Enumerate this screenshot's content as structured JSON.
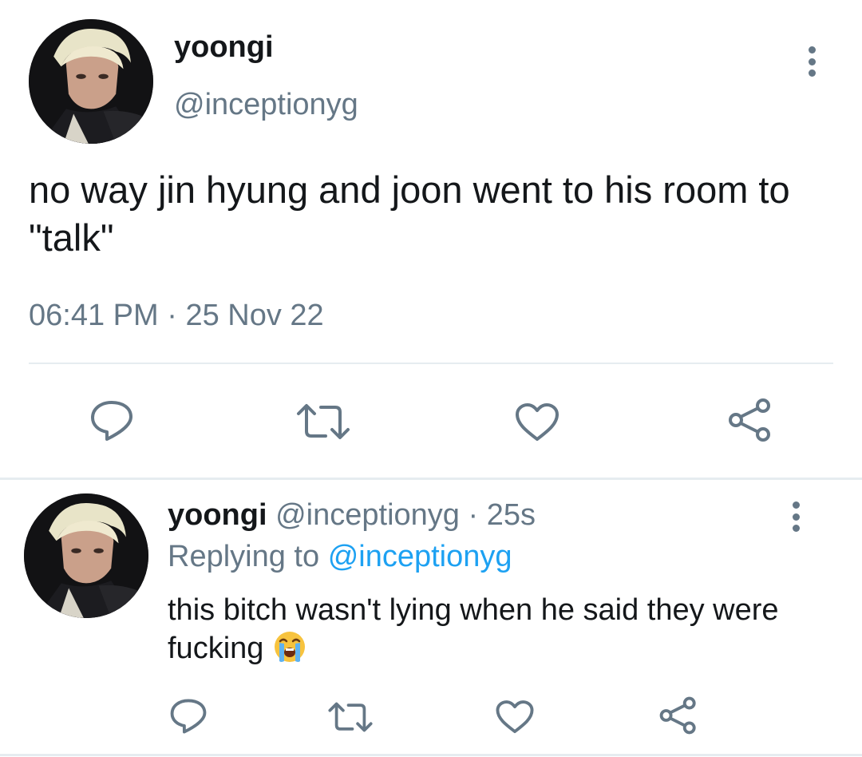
{
  "main_tweet": {
    "display_name": "yoongi",
    "handle": "@inceptionyg",
    "text": "no way jin hyung and joon went to his room to \"talk\"",
    "time": "06:41 PM",
    "separator": "·",
    "date": "25 Nov 22"
  },
  "reply_tweet": {
    "display_name": "yoongi",
    "handle": "@inceptionyg",
    "separator": "·",
    "age": "25s",
    "replying_prefix": "Replying to",
    "replying_mention": "@inceptionyg",
    "text": "this bitch wasn't lying when he said they were fucking",
    "emoji": "loudly-crying-face-emoji"
  },
  "icons": {
    "reply": "reply-icon",
    "retweet": "retweet-icon",
    "like": "heart-icon",
    "share": "share-icon",
    "more": "more-options-icon"
  },
  "colors": {
    "text_primary": "#14171a",
    "text_secondary": "#657786",
    "link": "#1da1f2",
    "divider": "#e6ecf0"
  }
}
